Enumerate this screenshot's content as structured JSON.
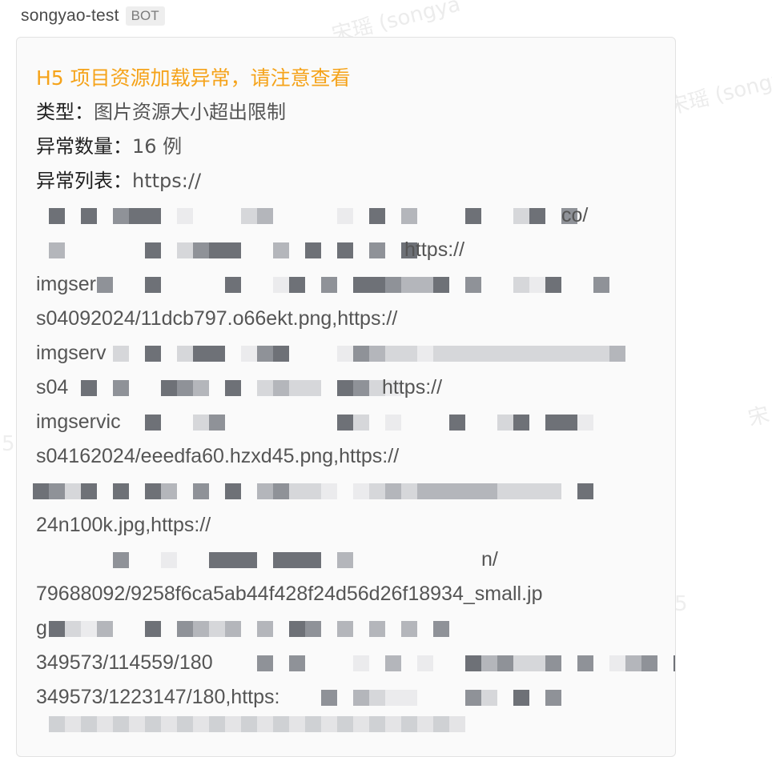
{
  "sender": {
    "name": "songyao-test",
    "badge": "BOT"
  },
  "watermarks": [
    "宋瑶 (songya",
    "宋瑶 (songy",
    "宋",
    "5",
    "5"
  ],
  "message": {
    "title": "H5 项目资源加载异常，请注意查看",
    "type_label": "类型：",
    "type_value": "图片资源大小超出限制",
    "count_label": "异常数量：",
    "count_value": "16 例",
    "list_label": "异常列表：",
    "list_value": "https://",
    "url_fragments": [
      "co/",
      "https://",
      "imgser",
      "s04092024/11dcb797.o66ekt.png,https://",
      "imgserv",
      "s04",
      "https://",
      "imgservic",
      "s04162024/eeedfa60.hzxd45.png,https://",
      "24n100k.jpg,https://",
      "n/",
      "79688092/9258f6ca5ab44f428f24d56d26f18934_small.jp",
      "g",
      "349573/114559/180",
      "349573/1223147/180,https:"
    ]
  }
}
